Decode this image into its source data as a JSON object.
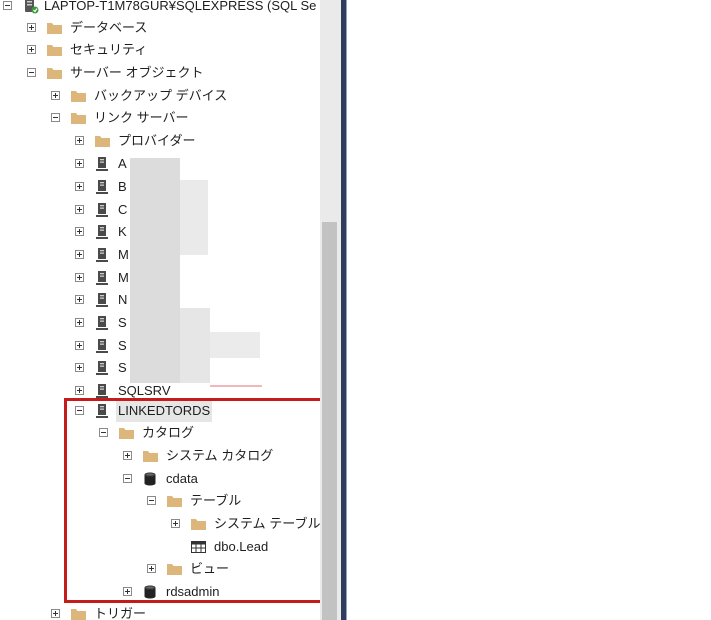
{
  "tree": {
    "server": "LAPTOP-T1M78GUR¥SQLEXPRESS (SQL Se",
    "databases": "データベース",
    "security": "セキュリティ",
    "server_objects": "サーバー オブジェクト",
    "backup_devices": "バックアップ デバイス",
    "linked_servers": "リンク サーバー",
    "providers": "プロバイダー",
    "linked_items": [
      "A",
      "B",
      "C",
      "K",
      "M",
      "M",
      "N",
      "S",
      "S",
      "S",
      "SQLSRV"
    ],
    "linkedtords": "LINKEDTORDS",
    "catalogs": "カタログ",
    "system_catalogs": "システム カタログ",
    "cdata": "cdata",
    "tables": "テーブル",
    "system_tables": "システム テーブル",
    "dbo_lead": "dbo.Lead",
    "views": "ビュー",
    "rdsadmin": "rdsadmin",
    "triggers": "トリガー"
  },
  "colors": {
    "folder": "#dcb67a",
    "highlight_border": "#c41b1b",
    "panel_divider": "#2e3d5c"
  }
}
